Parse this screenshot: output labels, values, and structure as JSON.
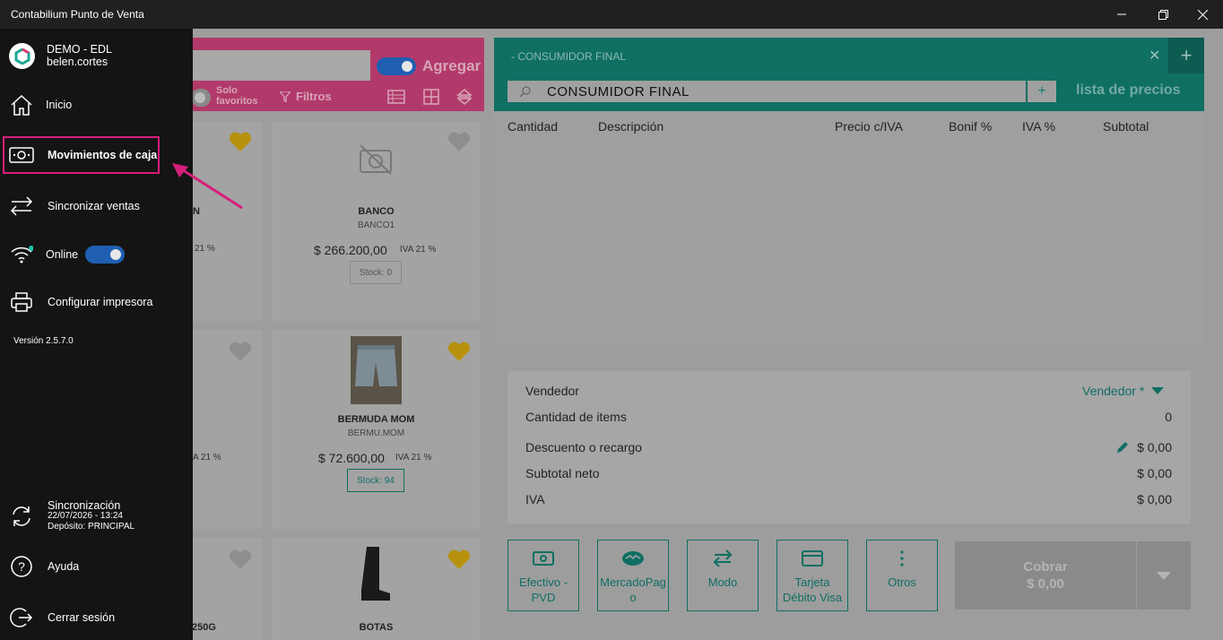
{
  "window": {
    "title": "Contabilium Punto de Venta"
  },
  "sidebar": {
    "account": {
      "company": "DEMO - EDL",
      "user": "belen.cortes"
    },
    "items": [
      {
        "label": "Inicio"
      },
      {
        "label": "Movimientos de caja"
      },
      {
        "label": "Sincronizar ventas"
      },
      {
        "label": "Online"
      },
      {
        "label": "Configurar impresora"
      }
    ],
    "version": "Versión 2.5.7.0",
    "sync": {
      "title": "Sincronización",
      "datetime": "22/07/2026 - 13:24",
      "deposit": "Depósito: PRINCIPAL"
    },
    "help": "Ayuda",
    "logout": "Cerrar sesión"
  },
  "products_panel": {
    "add_label": "Agregar",
    "solo_favoritos": "Solo favoritos",
    "filters_label": "Filtros",
    "cards": [
      {
        "name": "N",
        "price": "",
        "iva": "21 %",
        "favorite": true,
        "partial": true
      },
      {
        "name": "BANCO",
        "code": "BANCO1",
        "price": "$ 266.200,00",
        "iva": "IVA 21 %",
        "stock": "Stock: 0",
        "favorite": false
      },
      {
        "name": "",
        "iva": "A 21 %",
        "favorite": false,
        "partial": true
      },
      {
        "name": "BERMUDA MOM",
        "code": "BERMU.MOM",
        "price": "$ 72.600,00",
        "iva": "IVA 21 %",
        "stock": "Stock: 94",
        "favorite": true
      },
      {
        "name": "250G",
        "favorite": false,
        "partial": true
      },
      {
        "name": "BOTAS",
        "favorite": true
      }
    ]
  },
  "sale_panel": {
    "tab_label": "- CONSUMIDOR FINAL",
    "customer": "CONSUMIDOR FINAL",
    "price_list": "lista de precios",
    "columns": [
      "Cantidad",
      "Descripción",
      "Precio c/IVA",
      "Bonif %",
      "IVA %",
      "Subtotal"
    ],
    "totals": {
      "seller_label": "Vendedor",
      "seller_value": "Vendedor *",
      "items_label": "Cantidad de items",
      "items_value": "0",
      "discount_label": "Descuento o recargo",
      "discount_value": "$ 0,00",
      "subtotal_label": "Subtotal neto",
      "subtotal_value": "$ 0,00",
      "iva_label": "IVA",
      "iva_value": "$ 0,00"
    },
    "payments": [
      {
        "label": "Efectivo -\nPVD",
        "icon": "cash-icon"
      },
      {
        "label": "MercadoPag\no",
        "icon": "handshake-icon"
      },
      {
        "label": "Modo",
        "icon": "transfer-icon"
      },
      {
        "label": "Tarjeta\nDébito Visa",
        "icon": "card-icon"
      },
      {
        "label": "Otros",
        "icon": "more-icon"
      }
    ],
    "charge": {
      "label": "Cobrar",
      "amount": "$ 0,00"
    }
  },
  "colors": {
    "sidebar_bg": "#141414",
    "highlight": "#d61f7a",
    "brand_teal": "#0f6f63",
    "brand_pink": "#b23a6a",
    "toggle_blue": "#1f5fb2"
  }
}
